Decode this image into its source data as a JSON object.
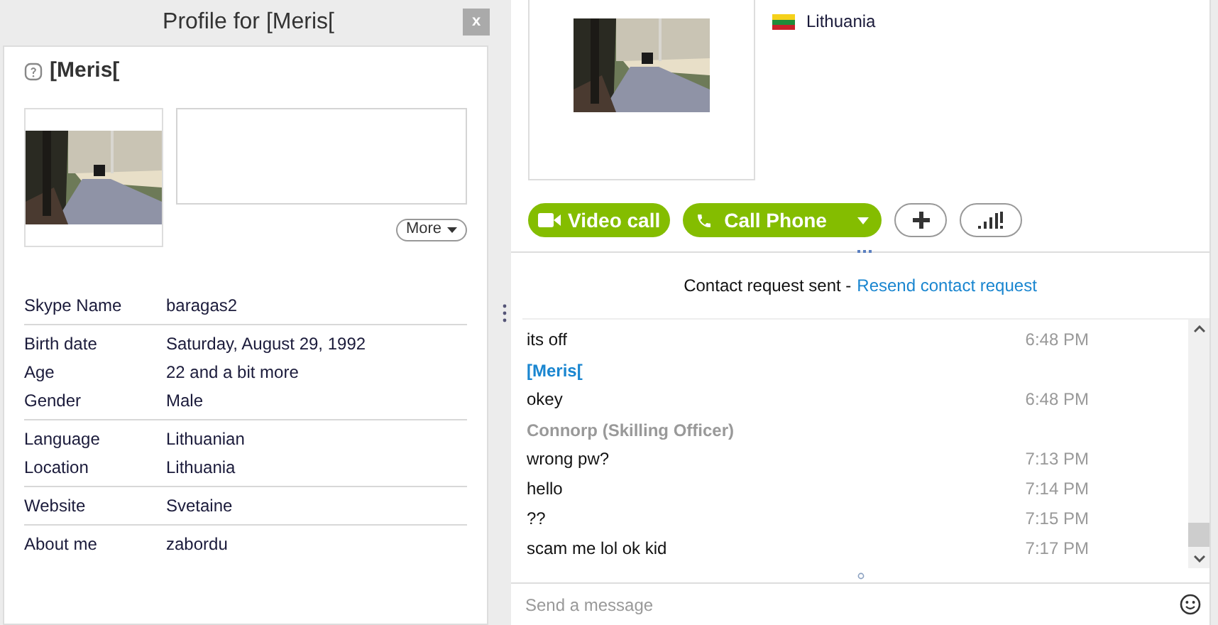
{
  "profile": {
    "title": "Profile for [Meris[",
    "close": "x",
    "name": "[Meris[",
    "more": "More",
    "field_groups": [
      [
        {
          "label": "Skype Name",
          "value": "baragas2"
        }
      ],
      [
        {
          "label": "Birth date",
          "value": "Saturday, August 29, 1992"
        },
        {
          "label": "Age",
          "value": "22 and a bit more"
        },
        {
          "label": "Gender",
          "value": "Male"
        }
      ],
      [
        {
          "label": "Language",
          "value": "Lithuanian"
        },
        {
          "label": "Location",
          "value": "Lithuania"
        }
      ],
      [
        {
          "label": "Website",
          "value": "Svetaine"
        }
      ],
      [
        {
          "label": "About me",
          "value": "zabordu"
        }
      ]
    ]
  },
  "contact": {
    "country": "Lithuania",
    "buttons": [
      {
        "kind": "video",
        "label": "Video call"
      },
      {
        "kind": "phone",
        "label": "Call Phone"
      },
      {
        "kind": "add"
      },
      {
        "kind": "signal"
      }
    ]
  },
  "chat": {
    "notice": "Contact request sent -",
    "notice_link": "Resend contact request",
    "messages": [
      {
        "kind": "message",
        "text": "its off",
        "time": "6:48 PM"
      },
      {
        "kind": "sender",
        "name": "[Meris[",
        "color": "#1a86d0"
      },
      {
        "kind": "message",
        "text": "okey",
        "time": "6:48 PM"
      },
      {
        "kind": "sender",
        "name": "Connorp (Skilling Officer)",
        "color": "#999999"
      },
      {
        "kind": "message",
        "text": "wrong pw?",
        "time": "7:13 PM"
      },
      {
        "kind": "message",
        "text": "hello",
        "time": "7:14 PM"
      },
      {
        "kind": "message",
        "text": "??",
        "time": "7:15 PM"
      },
      {
        "kind": "message",
        "text": "scam me lol ok kid",
        "time": "7:17 PM"
      }
    ],
    "input": {
      "placeholder": "Send a message"
    }
  }
}
